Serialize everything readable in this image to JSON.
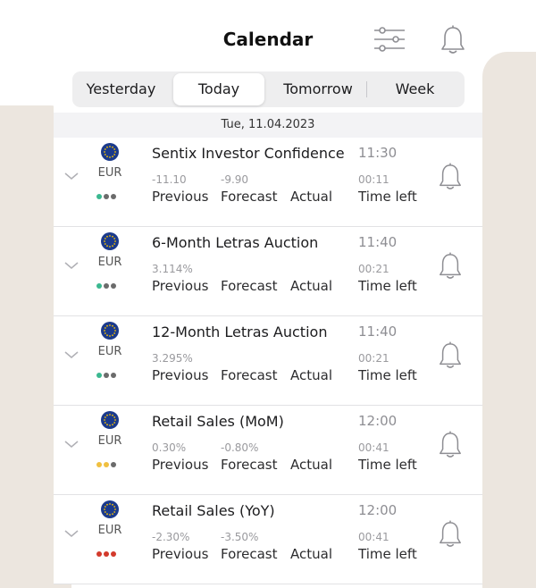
{
  "header": {
    "title": "Calendar",
    "filter_icon": "sliders-icon",
    "bell_icon": "bell-icon"
  },
  "tabs": [
    {
      "label": "Yesterday",
      "active": false
    },
    {
      "label": "Today",
      "active": true
    },
    {
      "label": "Tomorrow",
      "active": false
    },
    {
      "label": "Week",
      "active": false
    }
  ],
  "date_label": "Tue, 11.04.2023",
  "labels": {
    "previous": "Previous",
    "forecast": "Forecast",
    "actual": "Actual",
    "time_left": "Time left"
  },
  "colors": {
    "eu_flag": "#1b3a8c",
    "eu_stars": "#f6c200",
    "dot_green": "#3bb890",
    "dot_yellow": "#f0c040",
    "dot_red": "#d33a2c",
    "dot_gray": "#6b6b6b"
  },
  "events": [
    {
      "currency": "EUR",
      "name": "Sentix Investor Confidence",
      "previous": "-11.10",
      "forecast": "-9.90",
      "actual": "",
      "time": "11:30",
      "time_left": "00:11",
      "importance_dots": [
        "green",
        "gray",
        "gray"
      ]
    },
    {
      "currency": "EUR",
      "name": "6-Month Letras Auction",
      "previous": "3.114%",
      "forecast": "",
      "actual": "",
      "time": "11:40",
      "time_left": "00:21",
      "importance_dots": [
        "green",
        "gray",
        "gray"
      ]
    },
    {
      "currency": "EUR",
      "name": "12-Month Letras Auction",
      "previous": "3.295%",
      "forecast": "",
      "actual": "",
      "time": "11:40",
      "time_left": "00:21",
      "importance_dots": [
        "green",
        "gray",
        "gray"
      ]
    },
    {
      "currency": "EUR",
      "name": "Retail Sales (MoM)",
      "previous": "0.30%",
      "forecast": "-0.80%",
      "actual": "",
      "time": "12:00",
      "time_left": "00:41",
      "importance_dots": [
        "yellow",
        "yellow",
        "gray"
      ]
    },
    {
      "currency": "EUR",
      "name": "Retail Sales (YoY)",
      "previous": "-2.30%",
      "forecast": "-3.50%",
      "actual": "",
      "time": "12:00",
      "time_left": "00:41",
      "importance_dots": [
        "red",
        "red",
        "red"
      ]
    }
  ]
}
